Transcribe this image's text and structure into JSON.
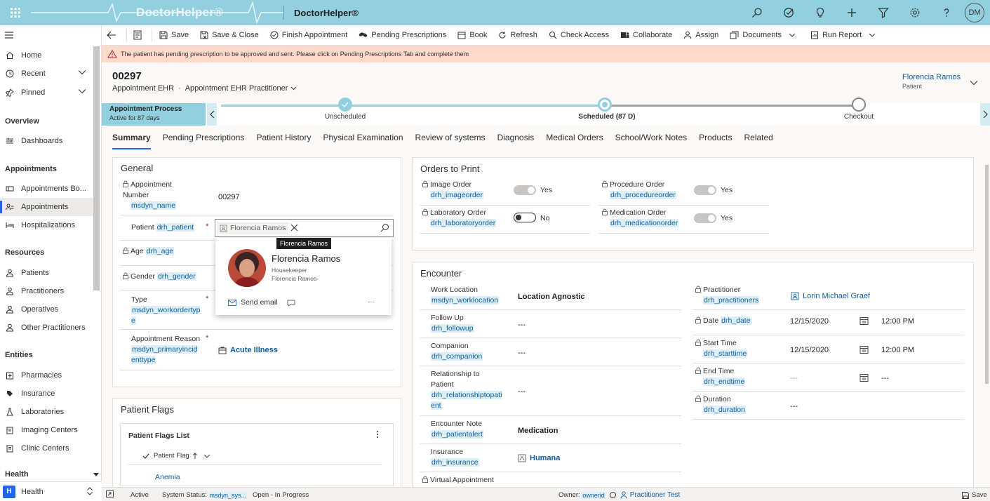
{
  "app": {
    "brand": "DoctorHelper®",
    "title": "DoctorHelper®",
    "user_initials": "DM"
  },
  "top_icons": [
    "search-icon",
    "task-icon",
    "lightbulb-icon",
    "plus-icon",
    "filter-icon",
    "settings-icon",
    "help-icon"
  ],
  "sidebar": {
    "home": "Home",
    "recent": "Recent",
    "pinned": "Pinned",
    "groups": {
      "overview": "Overview",
      "appointments": "Appointments",
      "resources": "Resources",
      "entities": "Entities",
      "health": "Health"
    },
    "items": {
      "dashboards": "Dashboards",
      "appointments_board": "Appointments Bo...",
      "appointments": "Appointments",
      "hospitalizations": "Hospitalizations",
      "patients": "Patients",
      "practitioners": "Practitioners",
      "operatives": "Operatives",
      "other_practitioners": "Other Practitioners",
      "pharmacies": "Pharmacies",
      "insurance": "Insurance",
      "laboratories": "Laboratories",
      "imaging_centers": "Imaging Centers",
      "clinic_centers": "Clinic Centers"
    },
    "area": {
      "badge": "H",
      "label": "Health"
    }
  },
  "commands": {
    "save": "Save",
    "save_close": "Save & Close",
    "finish": "Finish Appointment",
    "pending": "Pending Prescriptions",
    "book": "Book",
    "refresh": "Refresh",
    "check_access": "Check Access",
    "collaborate": "Collaborate",
    "assign": "Assign",
    "documents": "Documents",
    "run_report": "Run Report"
  },
  "notification": "The patient has pending prescription to be approved and sent. Please click on Pending Prescriptions Tab and complete them",
  "header": {
    "record_number": "00297",
    "entity": "Appointment EHR",
    "form": "Appointment EHR Practitioner",
    "owner_name": "Florencia Ramos",
    "owner_role": "Patient"
  },
  "bpf": {
    "process": "Appointment Process",
    "active_for": "Active for 87 days",
    "stages": [
      "Unscheduled",
      "Scheduled  (87 D)",
      "Checkout"
    ]
  },
  "tabs": [
    "Summary",
    "Pending Prescriptions",
    "Patient History",
    "Physical Examination",
    "Review of systems",
    "Diagnosis",
    "Medical Orders",
    "School/Work Notes",
    "Products",
    "Related"
  ],
  "general": {
    "title": "General",
    "appointment_number": {
      "label": "Appointment Number",
      "schema": "msdyn_name",
      "value": "00297"
    },
    "patient": {
      "label": "Patient",
      "schema": "drh_patient",
      "value": "Florencia Ramos"
    },
    "age": {
      "label": "Age",
      "schema": "drh_age"
    },
    "gender": {
      "label": "Gender",
      "schema": "drh_gender"
    },
    "type": {
      "label": "Type",
      "schema": "msdyn_workordertype"
    },
    "reason": {
      "label": "Appointment Reason",
      "schema": "msdyn_primaryincidenttype",
      "value": "Acute Illness"
    }
  },
  "contact_card": {
    "tooltip": "Florencia Ramos",
    "name": "Florencia Ramos",
    "job": "Housekeeper",
    "company": "Florencia Ramos",
    "send_email": "Send email"
  },
  "patient_flags": {
    "title": "Patient Flags",
    "list_title": "Patient Flags List",
    "column": "Patient Flag",
    "rows": [
      "Anemia"
    ]
  },
  "orders": {
    "title": "Orders to Print",
    "image": {
      "label": "Image Order",
      "schema": "drh_imageorder",
      "value": "Yes",
      "on": true
    },
    "procedure": {
      "label": "Procedure Order",
      "schema": "drh_procedureorder",
      "value": "Yes",
      "on": true
    },
    "laboratory": {
      "label": "Laboratory Order",
      "schema": "drh_laboratoryorder",
      "value": "No",
      "on": false
    },
    "medication": {
      "label": "Medication Order",
      "schema": "drh_medicationorder",
      "value": "Yes",
      "on": true
    }
  },
  "encounter": {
    "title": "Encounter",
    "work_location": {
      "label": "Work Location",
      "schema": "msdyn_worklocation",
      "value": "Location Agnostic"
    },
    "follow_up": {
      "label": "Follow Up",
      "schema": "drh_followup",
      "value": "---"
    },
    "companion": {
      "label": "Companion",
      "schema": "drh_companion",
      "value": "---"
    },
    "relationship": {
      "label": "Relationship to Patient",
      "schema": "drh_relationshiptopatient",
      "value": "---"
    },
    "note": {
      "label": "Encounter Note",
      "schema": "drh_patientalert",
      "value": "Medication"
    },
    "insurance": {
      "label": "Insurance",
      "schema": "drh_insurance",
      "value": "Humana"
    },
    "virtual": {
      "label": "Virtual Appointment"
    },
    "practitioner": {
      "label": "Practitioner",
      "schema": "drh_practitioners",
      "value": "Lorin Michael Graef"
    },
    "date": {
      "label": "Date",
      "schema": "drh_date",
      "value": "12/15/2020",
      "time": "12:00 PM"
    },
    "start_time": {
      "label": "Start Time",
      "schema": "drh_starttime",
      "value": "12/15/2020",
      "time": "12:00 PM"
    },
    "end_time": {
      "label": "End Time",
      "schema": "drh_endtime",
      "value": "---",
      "time": "---"
    },
    "duration": {
      "label": "Duration",
      "schema": "drh_duration",
      "value": "---"
    }
  },
  "statusbar": {
    "state": "Active",
    "system_status_label": "System Status:",
    "system_status_schema": "msdyn_sys...",
    "system_status_value": "Open - In Progress",
    "owner_label": "Owner:",
    "owner_schema": "ownerid",
    "owner_value": "Practitioner Test",
    "save": "Save"
  }
}
